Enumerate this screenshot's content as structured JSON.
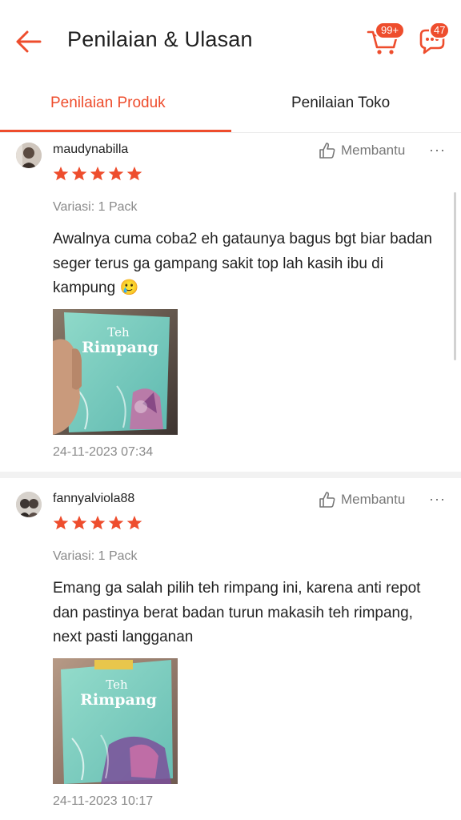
{
  "header": {
    "title": "Penilaian & Ulasan",
    "cart_badge": "99+",
    "chat_badge": "47"
  },
  "tabs": [
    {
      "label": "Penilaian Produk",
      "active": true
    },
    {
      "label": "Penilaian Toko",
      "active": false
    }
  ],
  "reviews": [
    {
      "username": "maudynabilla",
      "rating": 5,
      "helpful_label": "Membantu",
      "more": "···",
      "variant": "Variasi: 1 Pack",
      "comment": "Awalnya cuma coba2 eh gataunya bagus bgt biar badan seger terus ga gampang sakit top lah kasih ibu di kampung 🥲",
      "photo": {
        "line1": "Teh",
        "line2": "Rimpang"
      },
      "date": "24-11-2023 07:34"
    },
    {
      "username": "fannyalviola88",
      "rating": 5,
      "helpful_label": "Membantu",
      "more": "···",
      "variant": "Variasi: 1 Pack",
      "comment": "Emang ga salah pilih teh rimpang ini, karena anti repot dan pastinya berat badan turun makasih teh rimpang, next pasti langganan",
      "photo": {
        "line1": "Teh",
        "line2": "Rimpang"
      },
      "date": "24-11-2023 10:17"
    }
  ],
  "colors": {
    "accent": "#ee4d2d",
    "star": "#ee4d2d",
    "muted": "#8a8a8a"
  }
}
